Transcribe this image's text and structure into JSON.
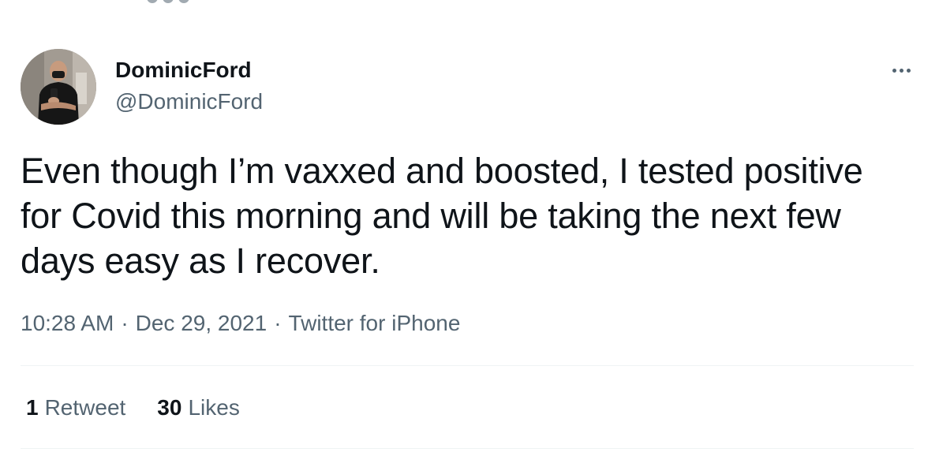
{
  "tweet": {
    "author": {
      "display_name": "DominicFord",
      "handle": "@DominicFord",
      "avatar_icon": "profile-photo-icon"
    },
    "more_icon": "more-options-icon",
    "text": "Even though I’m vaxxed and boosted, I tested positive for Covid this morning and will be taking the next few days easy as I recover.",
    "time": "10:28 AM",
    "date": "Dec 29, 2021",
    "source": "Twitter for iPhone",
    "separator": "·",
    "stats": {
      "retweets_count": "1",
      "retweets_label": "Retweet",
      "likes_count": "30",
      "likes_label": "Likes"
    }
  },
  "colors": {
    "primary_text": "#0f1419",
    "secondary_text": "#536471",
    "divider": "#eff3f4",
    "background": "#ffffff"
  }
}
